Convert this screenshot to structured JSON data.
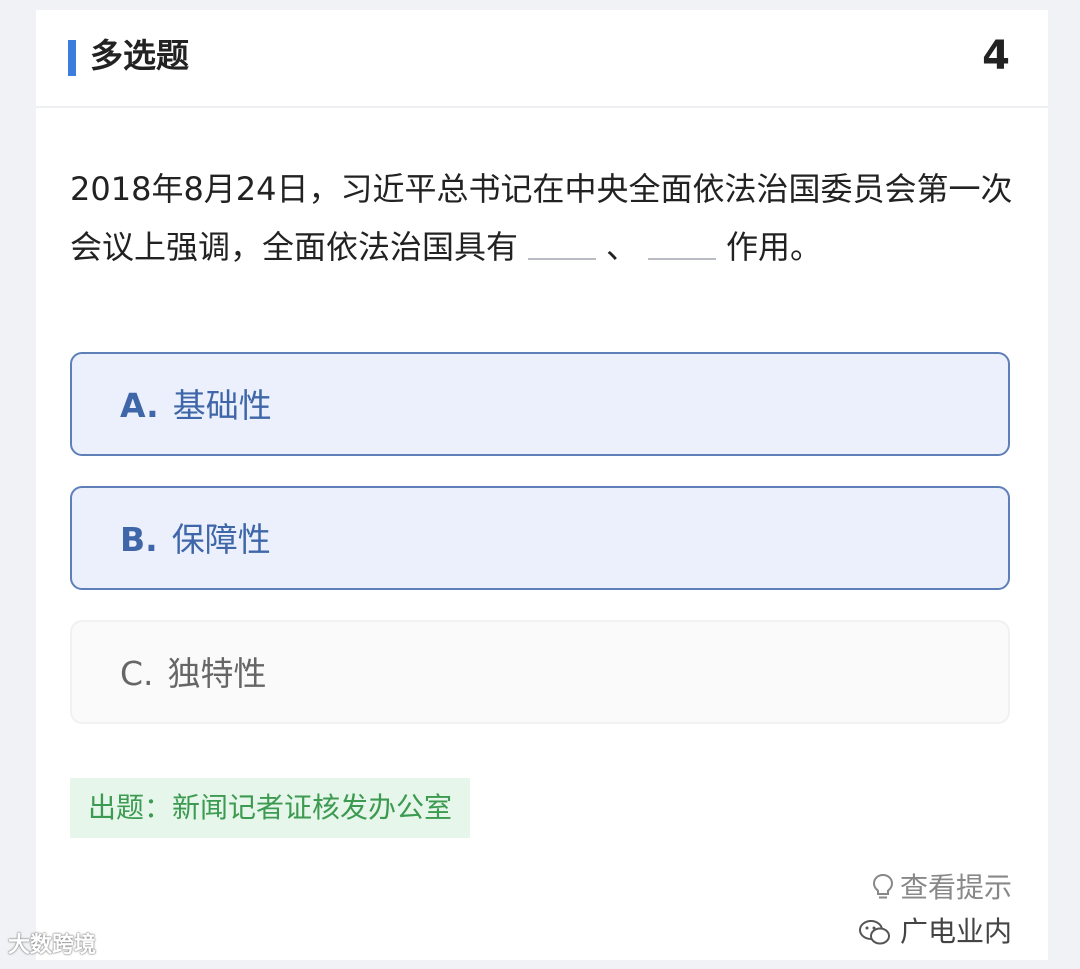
{
  "header": {
    "title": "多选题",
    "number": "4",
    "accent": "#3b7ddd"
  },
  "question": {
    "text_part1": "2018年8月24日，习近平总书记在中央全面依法治国委员会第一次会议上强调，全面依法治国具有",
    "separator": "、",
    "text_part2": "作用。"
  },
  "options": [
    {
      "letter": "A.",
      "label": "基础性",
      "selected": true
    },
    {
      "letter": "B.",
      "label": "保障性",
      "selected": true
    },
    {
      "letter": "C.",
      "label": "独特性",
      "selected": false
    }
  ],
  "source": {
    "label": "出题：新闻记者证核发办公室",
    "color": "#3c9a51"
  },
  "hint": {
    "icon": "lightbulb-icon",
    "label": "查看提示"
  },
  "watermarks": {
    "right": "广电业内",
    "right_icon": "wechat-icon",
    "left": "大数跨境"
  }
}
